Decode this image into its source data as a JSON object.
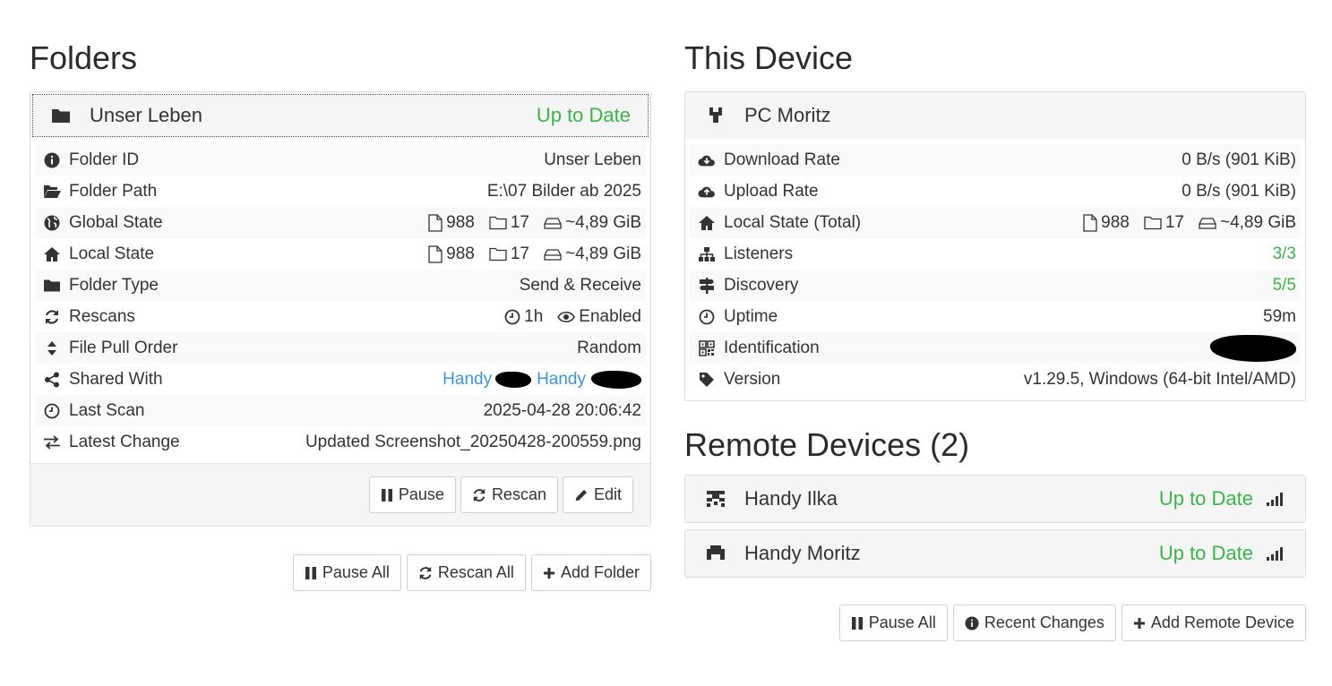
{
  "folders": {
    "heading": "Folders",
    "folder": {
      "name": "Unser Leben",
      "status": "Up to Date",
      "rows": {
        "folder_id": {
          "label": "Folder ID",
          "value": "Unser Leben"
        },
        "folder_path": {
          "label": "Folder Path",
          "value": "E:\\07 Bilder ab 2025"
        },
        "global_state": {
          "label": "Global State",
          "files": "988",
          "dirs": "17",
          "size": "~4,89 GiB"
        },
        "local_state": {
          "label": "Local State",
          "files": "988",
          "dirs": "17",
          "size": "~4,89 GiB"
        },
        "folder_type": {
          "label": "Folder Type",
          "value": "Send & Receive"
        },
        "rescans": {
          "label": "Rescans",
          "interval": "1h",
          "watcher": "Enabled"
        },
        "file_pull_order": {
          "label": "File Pull Order",
          "value": "Random"
        },
        "shared_with": {
          "label": "Shared With",
          "device1": "Handy",
          "device2": "Handy"
        },
        "last_scan": {
          "label": "Last Scan",
          "value": "2025-04-28 20:06:42"
        },
        "latest_change": {
          "label": "Latest Change",
          "value": "Updated Screenshot_20250428-200559.png"
        }
      },
      "buttons": {
        "pause": "Pause",
        "rescan": "Rescan",
        "edit": "Edit"
      }
    },
    "buttons": {
      "pause_all": "Pause All",
      "rescan_all": "Rescan All",
      "add_folder": "Add Folder"
    }
  },
  "this_device": {
    "heading": "This Device",
    "name": "PC Moritz",
    "rows": {
      "download_rate": {
        "label": "Download Rate",
        "value": "0 B/s (901 KiB)"
      },
      "upload_rate": {
        "label": "Upload Rate",
        "value": "0 B/s (901 KiB)"
      },
      "local_state_total": {
        "label": "Local State (Total)",
        "files": "988",
        "dirs": "17",
        "size": "~4,89 GiB"
      },
      "listeners": {
        "label": "Listeners",
        "value": "3/3"
      },
      "discovery": {
        "label": "Discovery",
        "value": "5/5"
      },
      "uptime": {
        "label": "Uptime",
        "value": "59m"
      },
      "identification": {
        "label": "Identification"
      },
      "version": {
        "label": "Version",
        "value": "v1.29.5, Windows (64-bit Intel/AMD)"
      }
    }
  },
  "remote_devices": {
    "heading": "Remote Devices (2)",
    "devices": [
      {
        "name": "Handy Ilka",
        "status": "Up to Date"
      },
      {
        "name": "Handy Moritz",
        "status": "Up to Date"
      }
    ],
    "buttons": {
      "pause_all": "Pause All",
      "recent_changes": "Recent Changes",
      "add_remote_device": "Add Remote Device"
    }
  },
  "colors": {
    "accent_green": "#3cb34a",
    "link_blue": "#3c96d3",
    "panel_bg": "#f5f5f5"
  }
}
